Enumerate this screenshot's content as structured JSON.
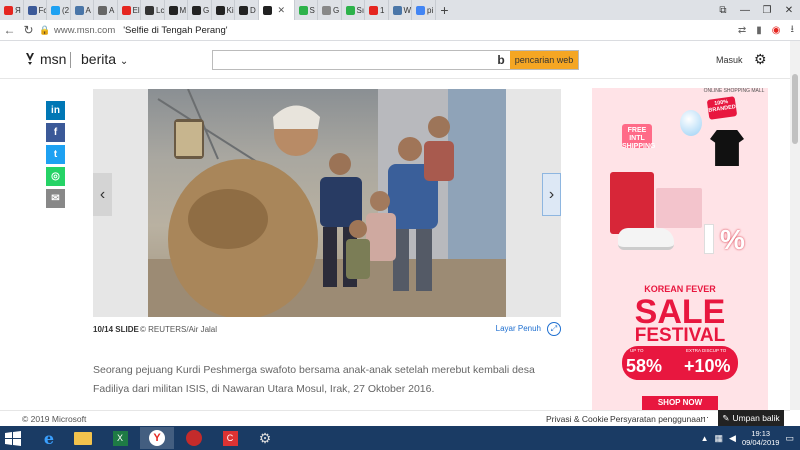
{
  "browser": {
    "tabs": [
      {
        "label": "Я",
        "color": "#e52620"
      },
      {
        "label": "Fc",
        "color": "#3b5998"
      },
      {
        "label": "(2",
        "color": "#1da1f2"
      },
      {
        "label": "A",
        "color": "#4a76a8"
      },
      {
        "label": "A",
        "color": "#666666"
      },
      {
        "label": "El",
        "color": "#e52620"
      },
      {
        "label": "Lc",
        "color": "#333333"
      },
      {
        "label": "M",
        "color": "#222222"
      },
      {
        "label": "G",
        "color": "#222222"
      },
      {
        "label": "Ki",
        "color": "#222222"
      },
      {
        "label": "D",
        "color": "#222222"
      },
      {
        "label": "",
        "color": "#222222",
        "active": true
      },
      {
        "label": "S",
        "color": "#2db24a"
      },
      {
        "label": "G",
        "color": "#888888"
      },
      {
        "label": "Sı",
        "color": "#2db24a"
      },
      {
        "label": "1",
        "color": "#e52620"
      },
      {
        "label": "W",
        "color": "#4a76a8"
      },
      {
        "label": "pi",
        "color": "#4285f4"
      }
    ],
    "new_tab_label": "+",
    "domain": "www.msn.com",
    "page_title": "'Selfie di Tengah Perang'"
  },
  "msn": {
    "logo_text": "msn",
    "section_label": "berita",
    "search_placeholder": "",
    "search_button_label": "pencarian web",
    "signin_label": "Masuk"
  },
  "share_buttons": [
    {
      "name": "linkedin",
      "glyph": "in",
      "color": "#0077b5"
    },
    {
      "name": "facebook",
      "glyph": "f",
      "color": "#3b5998"
    },
    {
      "name": "twitter",
      "glyph": "t",
      "color": "#1da1f2"
    },
    {
      "name": "whatsapp",
      "glyph": "◎",
      "color": "#25d366"
    },
    {
      "name": "email",
      "glyph": "✉",
      "color": "#888888"
    }
  ],
  "slideshow": {
    "counter": "10/14 SLIDE",
    "credit": "© REUTERS/Air Jalal",
    "fullscreen_label": "Layar Penuh",
    "prev_glyph": "‹",
    "next_glyph": "›"
  },
  "article": {
    "body": "Seorang pejuang Kurdi Peshmerga swafoto bersama anak-anak setelah merebut kembali desa Fadiliya dari militan ISIS, di Nawaran Utara Mosul, Irak, 27 Oktober 2016."
  },
  "ad": {
    "header": "ONLINE SHOPPING MALL",
    "badge": "100% BRANDED",
    "free_shipping": "FREE INTL SHIPPING",
    "headline": "KOREAN FEVER",
    "sale": "SALE",
    "festival": "FESTIVAL",
    "discount_label_1": "UP TO",
    "discount_value_1": "58%",
    "discount_label_2": "EXTRA DISCUP TO",
    "discount_value_2": "+10%",
    "cta": "SHOP NOW",
    "percent_graphic": "%"
  },
  "footer": {
    "copyright": "© 2019 Microsoft",
    "privacy": "Privasi & Cookie",
    "terms": "Persyaratan penggunaan",
    "more": "···",
    "feedback": "Umpan balik"
  },
  "taskbar": {
    "time": "19:13",
    "date": "09/04/2019"
  }
}
